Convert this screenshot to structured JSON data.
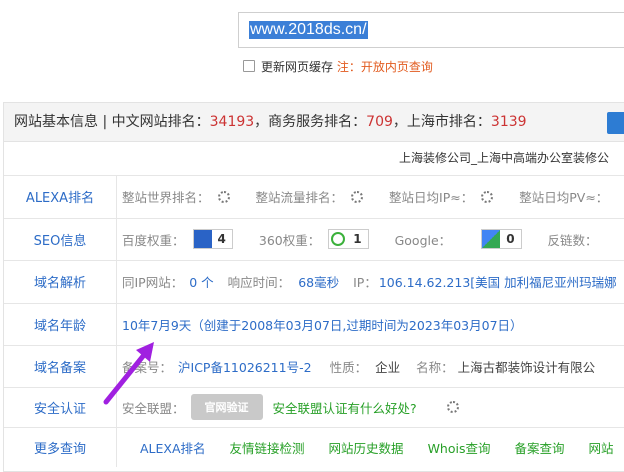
{
  "search": {
    "value": "www.2018ds.cn/"
  },
  "cache": {
    "label": "更新网页缓存",
    "note": "注：开放内页查询"
  },
  "header": {
    "title": "网站基本信息",
    "sep": "|",
    "cn_rank_label": "中文网站排名：",
    "cn_rank": "34193",
    "biz_rank_label": "，商务服务排名：",
    "biz_rank": "709",
    "sh_rank_label": "，上海市排名：",
    "sh_rank": "3139"
  },
  "site_title": "上海装修公司_上海中高端办公室装修公",
  "rows": {
    "alexa": {
      "label": "ALEXA排名",
      "world": "整站世界排名：",
      "traffic": "整站流量排名：",
      "ip": "整站日均IP≈：",
      "pv": "整站日均PV≈："
    },
    "seo": {
      "label": "SEO信息",
      "baidu": "百度权重：",
      "baidu_val": "4",
      "s360": "360权重：",
      "s360_val": "1",
      "google": "Google：",
      "google_val": "0",
      "backlinks": "反链数："
    },
    "dns": {
      "label": "域名解析",
      "sameip": "同IP网站：",
      "sameip_val": "0 个",
      "resp": "响应时间：",
      "resp_val": "68毫秒",
      "ip": "IP：",
      "ip_val": "106.14.62.213[美国 加利福尼亚州玛瑞娜"
    },
    "age": {
      "label": "域名年龄",
      "value": "10年7月9天（创建于2008年03月07日,过期时间为2023年03月07日）"
    },
    "icp": {
      "label": "域名备案",
      "no_label": "备案号：",
      "no_val": "沪ICP备11026211号-2",
      "nature": "性质：",
      "nature_val": "企业",
      "name": "名称：",
      "name_val": "上海古都装饰设计有限公"
    },
    "security": {
      "label": "安全认证",
      "alliance": "安全联盟：",
      "seal": "官网验证",
      "link": "安全联盟认证有什么好处?"
    },
    "more": {
      "label": "更多查询",
      "links": [
        "ALEXA排名",
        "友情链接检测",
        "网站历史数据",
        "Whois查询",
        "备案查询",
        "网站"
      ]
    }
  },
  "colors": {
    "accent": "#2d6cc7",
    "rank": "#cc3333",
    "link_green": "#28a028",
    "arrow": "#a020e0"
  }
}
